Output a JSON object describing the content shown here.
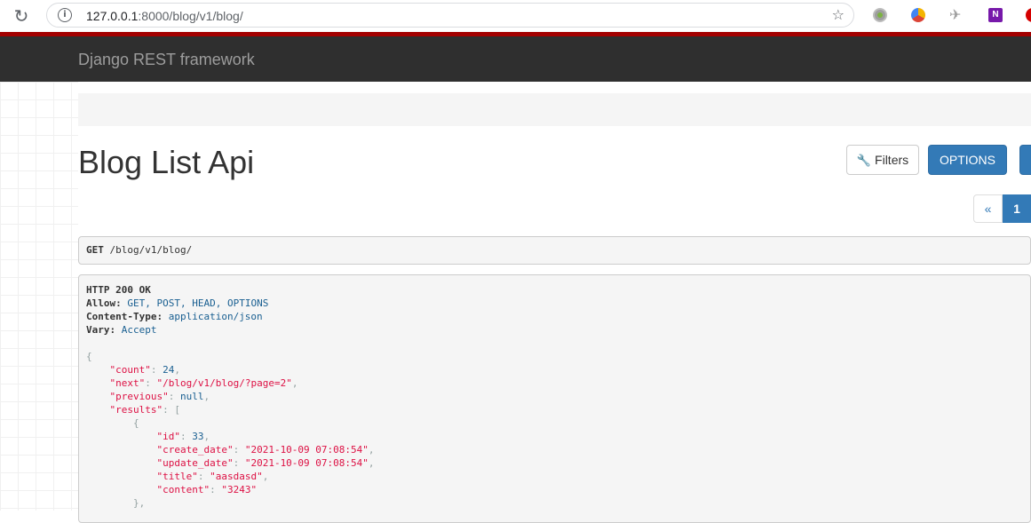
{
  "browser": {
    "url_host": "127.0.0.1",
    "url_rest": ":8000/blog/v1/blog/",
    "reload_icon": "reload-icon",
    "info_icon": "info-icon",
    "bookmark_icon": "star-add-icon",
    "extensions": [
      "circle-extension-icon",
      "colorful-extension-icon",
      "bird-extension-icon",
      "onenote-icon",
      "red-extension-icon"
    ],
    "extension_onenote_label": "N"
  },
  "navbar": {
    "brand": "Django REST framework",
    "accent_color": "#a30000",
    "background": "#2f2f2f"
  },
  "page": {
    "title": "Blog List Api",
    "filters_label": "Filters",
    "options_label": "OPTIONS",
    "pager": {
      "prev": "«",
      "current": "1"
    }
  },
  "request": {
    "method": "GET",
    "path": "/blog/v1/blog/"
  },
  "response": {
    "status_line": "HTTP 200 OK",
    "headers": [
      {
        "name": "Allow:",
        "value": "GET, POST, HEAD, OPTIONS"
      },
      {
        "name": "Content-Type:",
        "value": "application/json"
      },
      {
        "name": "Vary:",
        "value": "Accept"
      }
    ],
    "body": {
      "count_key": "\"count\"",
      "count_value": "24",
      "next_key": "\"next\"",
      "next_value": "\"/blog/v1/blog/?page=2\"",
      "previous_key": "\"previous\"",
      "previous_value": "null",
      "results_key": "\"results\"",
      "item": {
        "id_key": "\"id\"",
        "id_value": "33",
        "create_key": "\"create_date\"",
        "create_value": "\"2021-10-09 07:08:54\"",
        "update_key": "\"update_date\"",
        "update_value": "\"2021-10-09 07:08:54\"",
        "title_key": "\"title\"",
        "title_value": "\"aasdasd\"",
        "content_key": "\"content\"",
        "content_value": "\"3243\""
      }
    }
  }
}
